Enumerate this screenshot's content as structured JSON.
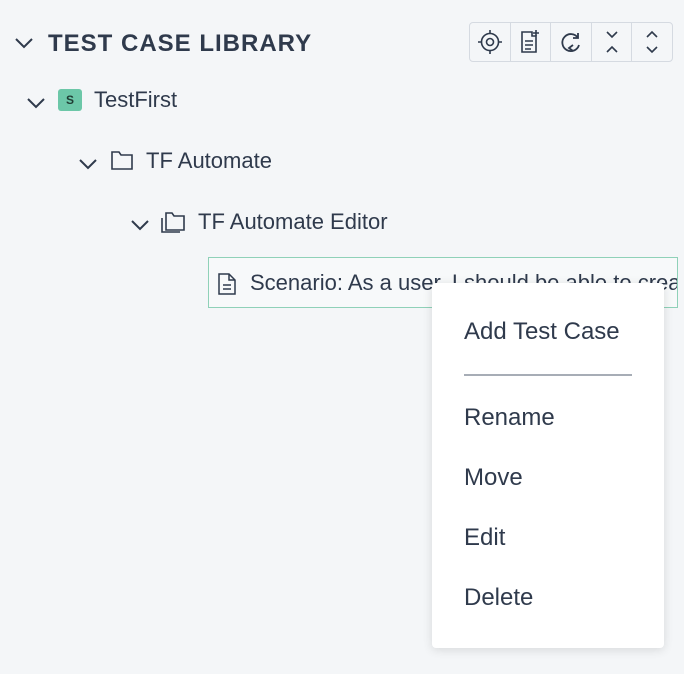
{
  "panel": {
    "title": "TEST CASE LIBRARY",
    "toolbar": [
      {
        "name": "locate",
        "icon": "crosshair-icon"
      },
      {
        "name": "add-test-case",
        "icon": "add-document-icon"
      },
      {
        "name": "refresh",
        "icon": "refresh-icon"
      },
      {
        "name": "collapse-all",
        "icon": "collapse-icon"
      },
      {
        "name": "expand-all",
        "icon": "expand-icon"
      }
    ]
  },
  "tree": {
    "suite": {
      "badge": "S",
      "label": "TestFirst"
    },
    "folder": {
      "label": "TF Automate"
    },
    "subfolder": {
      "label": "TF Automate Editor"
    },
    "test_case": {
      "label": "Scenario: As a user, I should be able to create and edit test cases"
    }
  },
  "context_menu": {
    "items": [
      "Add Test Case",
      "Rename",
      "Move",
      "Edit",
      "Delete"
    ]
  },
  "colors": {
    "background": "#f4f6f8",
    "text": "#2f3a4c",
    "badge": "#6cc7a8",
    "selection_border": "#8fd1b8"
  }
}
